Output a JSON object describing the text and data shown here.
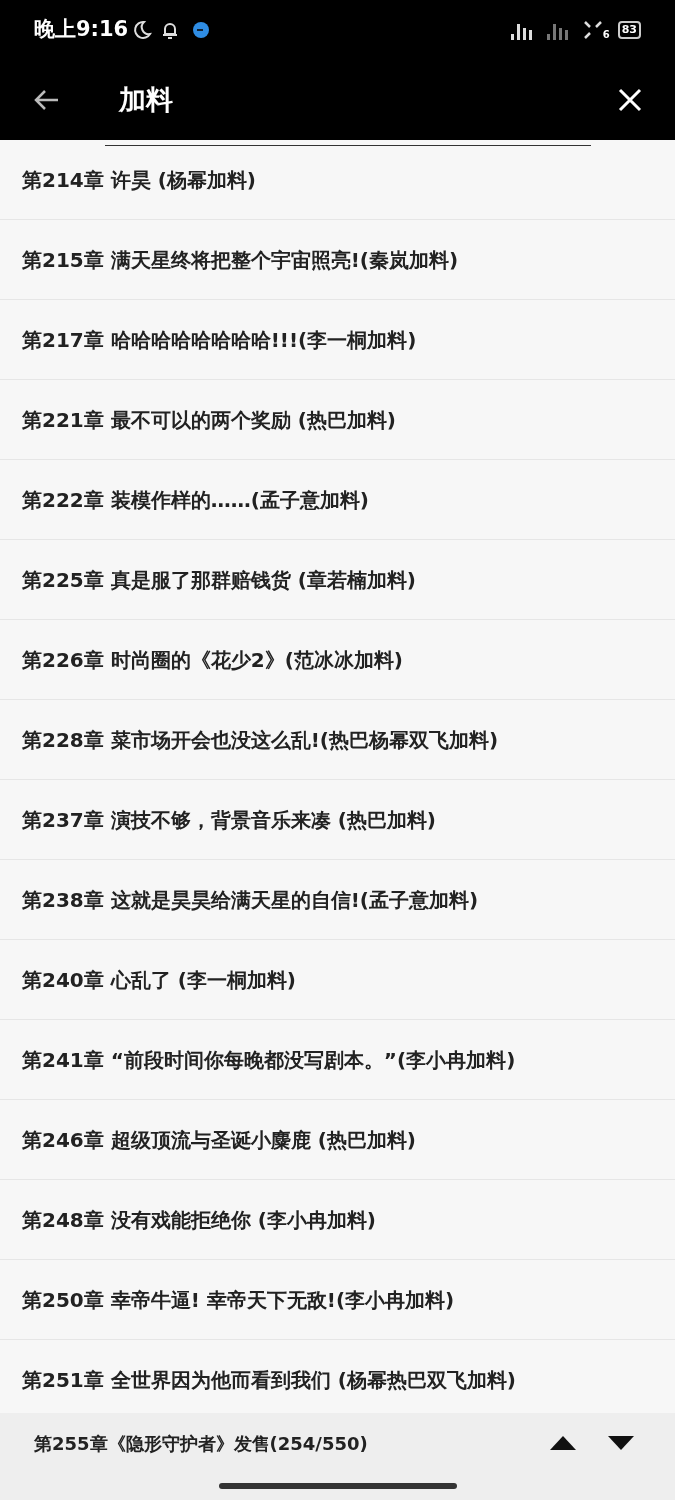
{
  "status_bar": {
    "time": "晚上9:16",
    "battery": "83",
    "network_badge": "6"
  },
  "header": {
    "query": "加料"
  },
  "results": [
    {
      "title": "第214章 许昊 (杨幂加料)"
    },
    {
      "title": "第215章 满天星终将把整个宇宙照亮!(秦岚加料)"
    },
    {
      "title": "第217章 哈哈哈哈哈哈哈哈!!!(李一桐加料)"
    },
    {
      "title": "第221章 最不可以的两个奖励 (热巴加料)"
    },
    {
      "title": "第222章 装模作样的……(孟子意加料)"
    },
    {
      "title": "第225章 真是服了那群赔钱货 (章若楠加料)"
    },
    {
      "title": "第226章 时尚圈的《花少2》(范冰冰加料)"
    },
    {
      "title": "第228章 菜市场开会也没这么乱!(热巴杨幂双飞加料)"
    },
    {
      "title": "第237章 演技不够，背景音乐来凑 (热巴加料)"
    },
    {
      "title": "第238章 这就是昊昊给满天星的自信!(孟子意加料)"
    },
    {
      "title": "第240章 心乱了 (李一桐加料)"
    },
    {
      "title": "第241章 “前段时间你每晚都没写剧本。”(李小冉加料)"
    },
    {
      "title": "第246章 超级顶流与圣诞小麋鹿 (热巴加料)"
    },
    {
      "title": "第248章 没有戏能拒绝你 (李小冉加料)"
    },
    {
      "title": "第250章 幸帝牛逼! 幸帝天下无敌!(李小冉加料)"
    },
    {
      "title": "第251章 全世界因为他而看到我们 (杨幂热巴双飞加料)"
    }
  ],
  "footer": {
    "current": "第255章《隐形守护者》发售(254/550)"
  }
}
